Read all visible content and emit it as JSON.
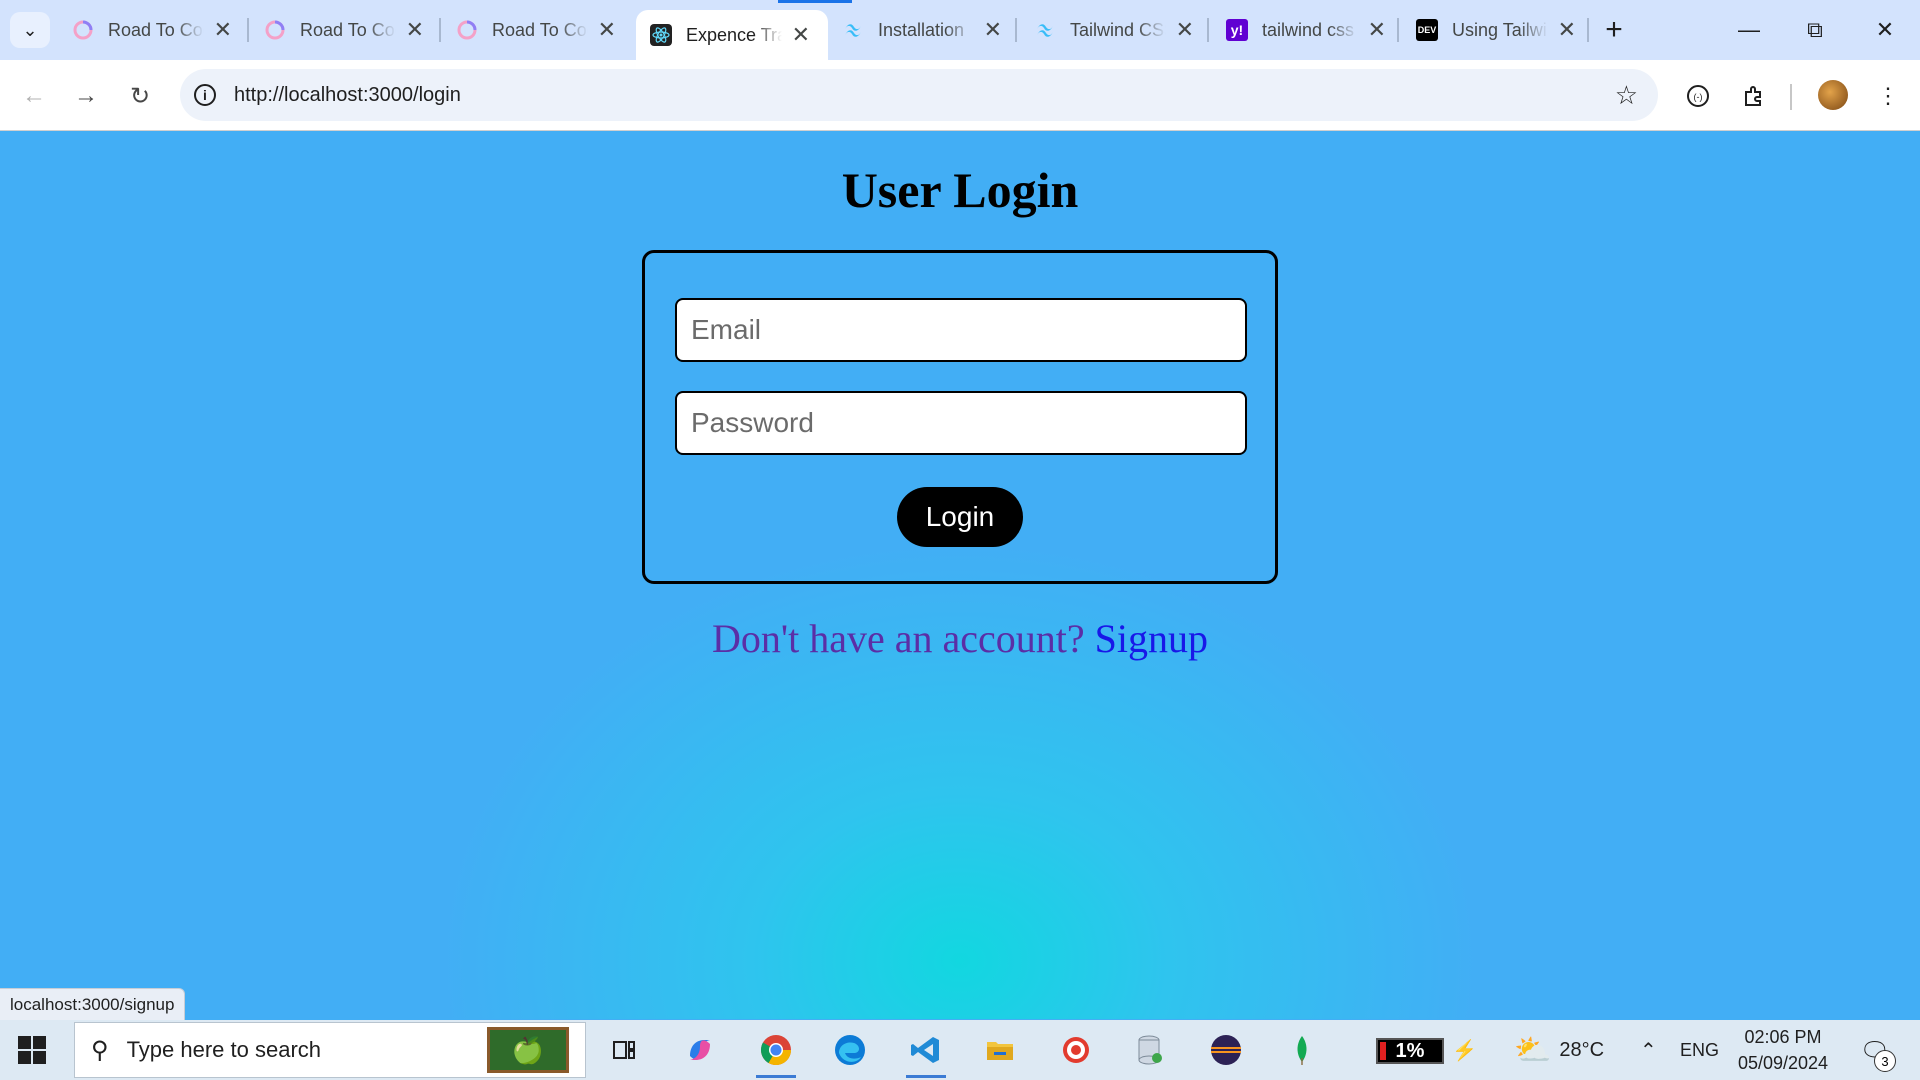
{
  "browser": {
    "tabs": [
      {
        "title": "Road To Code",
        "favicon": "road-to-code-icon",
        "active": false
      },
      {
        "title": "Road To Code",
        "favicon": "road-to-code-icon",
        "active": false
      },
      {
        "title": "Road To Code",
        "favicon": "road-to-code-icon",
        "active": false
      },
      {
        "title": "Expence Tracker",
        "favicon": "react-icon",
        "active": true
      },
      {
        "title": "Installation",
        "favicon": "tailwind-icon",
        "active": false
      },
      {
        "title": "Tailwind CSS",
        "favicon": "tailwind-icon",
        "active": false
      },
      {
        "title": "tailwind css",
        "favicon": "yahoo-icon",
        "active": false
      },
      {
        "title": "Using Tailwind",
        "favicon": "dev-icon",
        "active": false
      }
    ],
    "favicon_text": {
      "yahoo": "y!",
      "dev": "DEV"
    },
    "url": "http://localhost:3000/login",
    "status_tip": "localhost:3000/signup"
  },
  "page": {
    "title": "User Login",
    "email_placeholder": "Email",
    "password_placeholder": "Password",
    "login_label": "Login",
    "signup_prompt": "Don't have an account?",
    "signup_link": "Signup"
  },
  "taskbar": {
    "search_placeholder": "Type here to search",
    "battery_percent": "1%",
    "weather": "28°C",
    "language": "ENG",
    "time": "02:06 PM",
    "date": "05/09/2024",
    "notification_count": "3"
  }
}
